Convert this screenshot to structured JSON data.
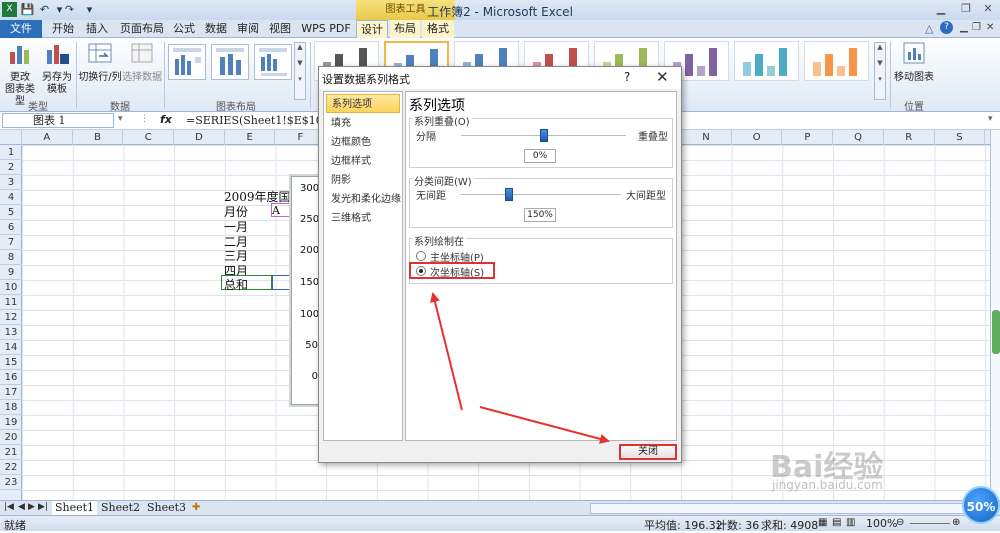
{
  "window": {
    "title": "工作簿2 - Microsoft Excel",
    "chart_tools_label": "图表工具"
  },
  "tabs": [
    "文件",
    "开始",
    "插入",
    "页面布局",
    "公式",
    "数据",
    "审阅",
    "视图",
    "WPS PDF",
    "设计",
    "布局",
    "格式"
  ],
  "ribbon": {
    "change_type_label": "更改\n图表类型",
    "save_template_label": "另存为\n模板",
    "switch_row_col_label": "切换行/列",
    "select_data_label": "选择数据",
    "move_chart_label": "移动图表",
    "groups": {
      "type": "类型",
      "data": "数据",
      "layout": "图表布局",
      "location": "位置"
    },
    "style_colors": [
      "#555555",
      "#4f81bd",
      "#4f81bd",
      "#c0504d",
      "#9bbb59",
      "#8064a2",
      "#4bacc6",
      "#f79646"
    ]
  },
  "formula_bar": {
    "name_box": "图表 1",
    "fx": "fx",
    "formula": "=SERIES(Sheet1!$E$10,Sheet1!$F$5:$F$9,Sheet1!$F$10,2)"
  },
  "grid": {
    "columns": [
      "A",
      "B",
      "C",
      "D",
      "E",
      "F",
      "G",
      "H",
      "I",
      "J",
      "K",
      "L",
      "M",
      "N",
      "O",
      "P",
      "Q",
      "R",
      "S"
    ],
    "rows": [
      "1",
      "2",
      "3",
      "4",
      "5",
      "6",
      "7",
      "8",
      "9",
      "10",
      "11",
      "12",
      "13",
      "14",
      "15",
      "16",
      "17",
      "18",
      "19",
      "20",
      "21",
      "22",
      "23"
    ],
    "cells": {
      "e4": "2009年度国美",
      "e5": "月份",
      "f5": "A",
      "e6": "一月",
      "e7": "二月",
      "e8": "三月",
      "e9": "四月",
      "e10": "总和"
    }
  },
  "chart": {
    "y_ticks": [
      "300",
      "250",
      "200",
      "150",
      "100",
      "50",
      "0"
    ]
  },
  "dialog": {
    "title": "设置数据系列格式",
    "help": "?",
    "close_glyph": "✕",
    "nav_items": [
      "系列选项",
      "填充",
      "边框颜色",
      "边框样式",
      "阴影",
      "发光和柔化边缘",
      "三维格式"
    ],
    "section_title": "系列选项",
    "overlap": {
      "legend": "系列重叠(O)",
      "left": "分隔",
      "right": "重叠型",
      "value": "0%",
      "fraction": 0.5
    },
    "gap": {
      "legend": "分类间距(W)",
      "left": "无间距",
      "right": "大间距型",
      "value": "150%",
      "fraction": 0.3
    },
    "plot_on": {
      "legend": "系列绘制在",
      "primary": "主坐标轴(P)",
      "secondary": "次坐标轴(S)",
      "selected": "secondary"
    },
    "close_button": "关闭"
  },
  "sheets": [
    "Sheet1",
    "Sheet2",
    "Sheet3"
  ],
  "status": {
    "ready": "就绪",
    "average": "平均值: 196.32",
    "count": "计数: 36",
    "sum": "求和: 4908",
    "zoom": "100%"
  },
  "watermark": {
    "brand": "Bai经验",
    "url": "jingyan.baidu.com"
  },
  "badge": "50%"
}
